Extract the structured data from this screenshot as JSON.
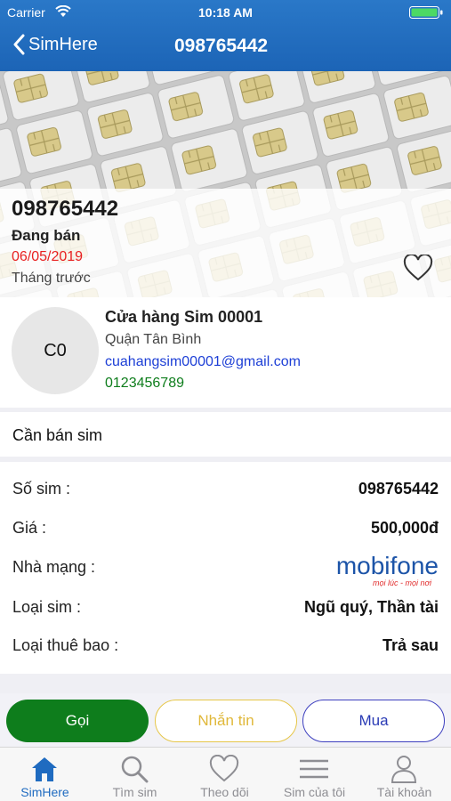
{
  "status_bar": {
    "carrier": "Carrier",
    "time": "10:18 AM"
  },
  "nav": {
    "back_label": "SimHere",
    "title": "098765442"
  },
  "hero": {
    "sim_number": "098765442",
    "sale_status": "Đang bán",
    "date": "06/05/2019",
    "relative_time": "Tháng trước"
  },
  "store": {
    "avatar_initials": "C0",
    "name": "Cửa hàng Sim 00001",
    "district": "Quận Tân Bình",
    "email": "cuahangsim00001@gmail.com",
    "phone": "0123456789"
  },
  "post": {
    "title": "Cần bán sim"
  },
  "details": {
    "sim_number": {
      "label": "Số sim :",
      "value": "098765442"
    },
    "price": {
      "label": "Giá :",
      "value": "500,000đ"
    },
    "network": {
      "label": "Nhà mạng :",
      "logo_text": "mobifone",
      "logo_tagline": "mọi lúc - mọi nơi"
    },
    "sim_type": {
      "label": "Loại sim :",
      "value": "Ngũ quý, Thần tài"
    },
    "subscription": {
      "label": "Loại thuê bao :",
      "value": "Trả sau"
    }
  },
  "actions": {
    "call": "Gọi",
    "message": "Nhắn tin",
    "buy": "Mua"
  },
  "tabs": [
    {
      "label": "SimHere",
      "icon": "home-icon",
      "active": true
    },
    {
      "label": "Tìm sim",
      "icon": "search-icon",
      "active": false
    },
    {
      "label": "Theo dõi",
      "icon": "heart-icon",
      "active": false
    },
    {
      "label": "Sim của tôi",
      "icon": "list-icon",
      "active": false
    },
    {
      "label": "Tài khoản",
      "icon": "user-icon",
      "active": false
    }
  ],
  "colors": {
    "header": "#1c64b6",
    "date": "#e82020",
    "email": "#1d3fd6",
    "phone": "#0e7d1c",
    "call_button": "#0e7d1c",
    "message_border": "#e6c648",
    "buy_border": "#3d3fbf",
    "tab_active": "#1f6bc0",
    "mobifone_blue": "#1c54a8",
    "mobifone_red": "#e12b2b"
  }
}
